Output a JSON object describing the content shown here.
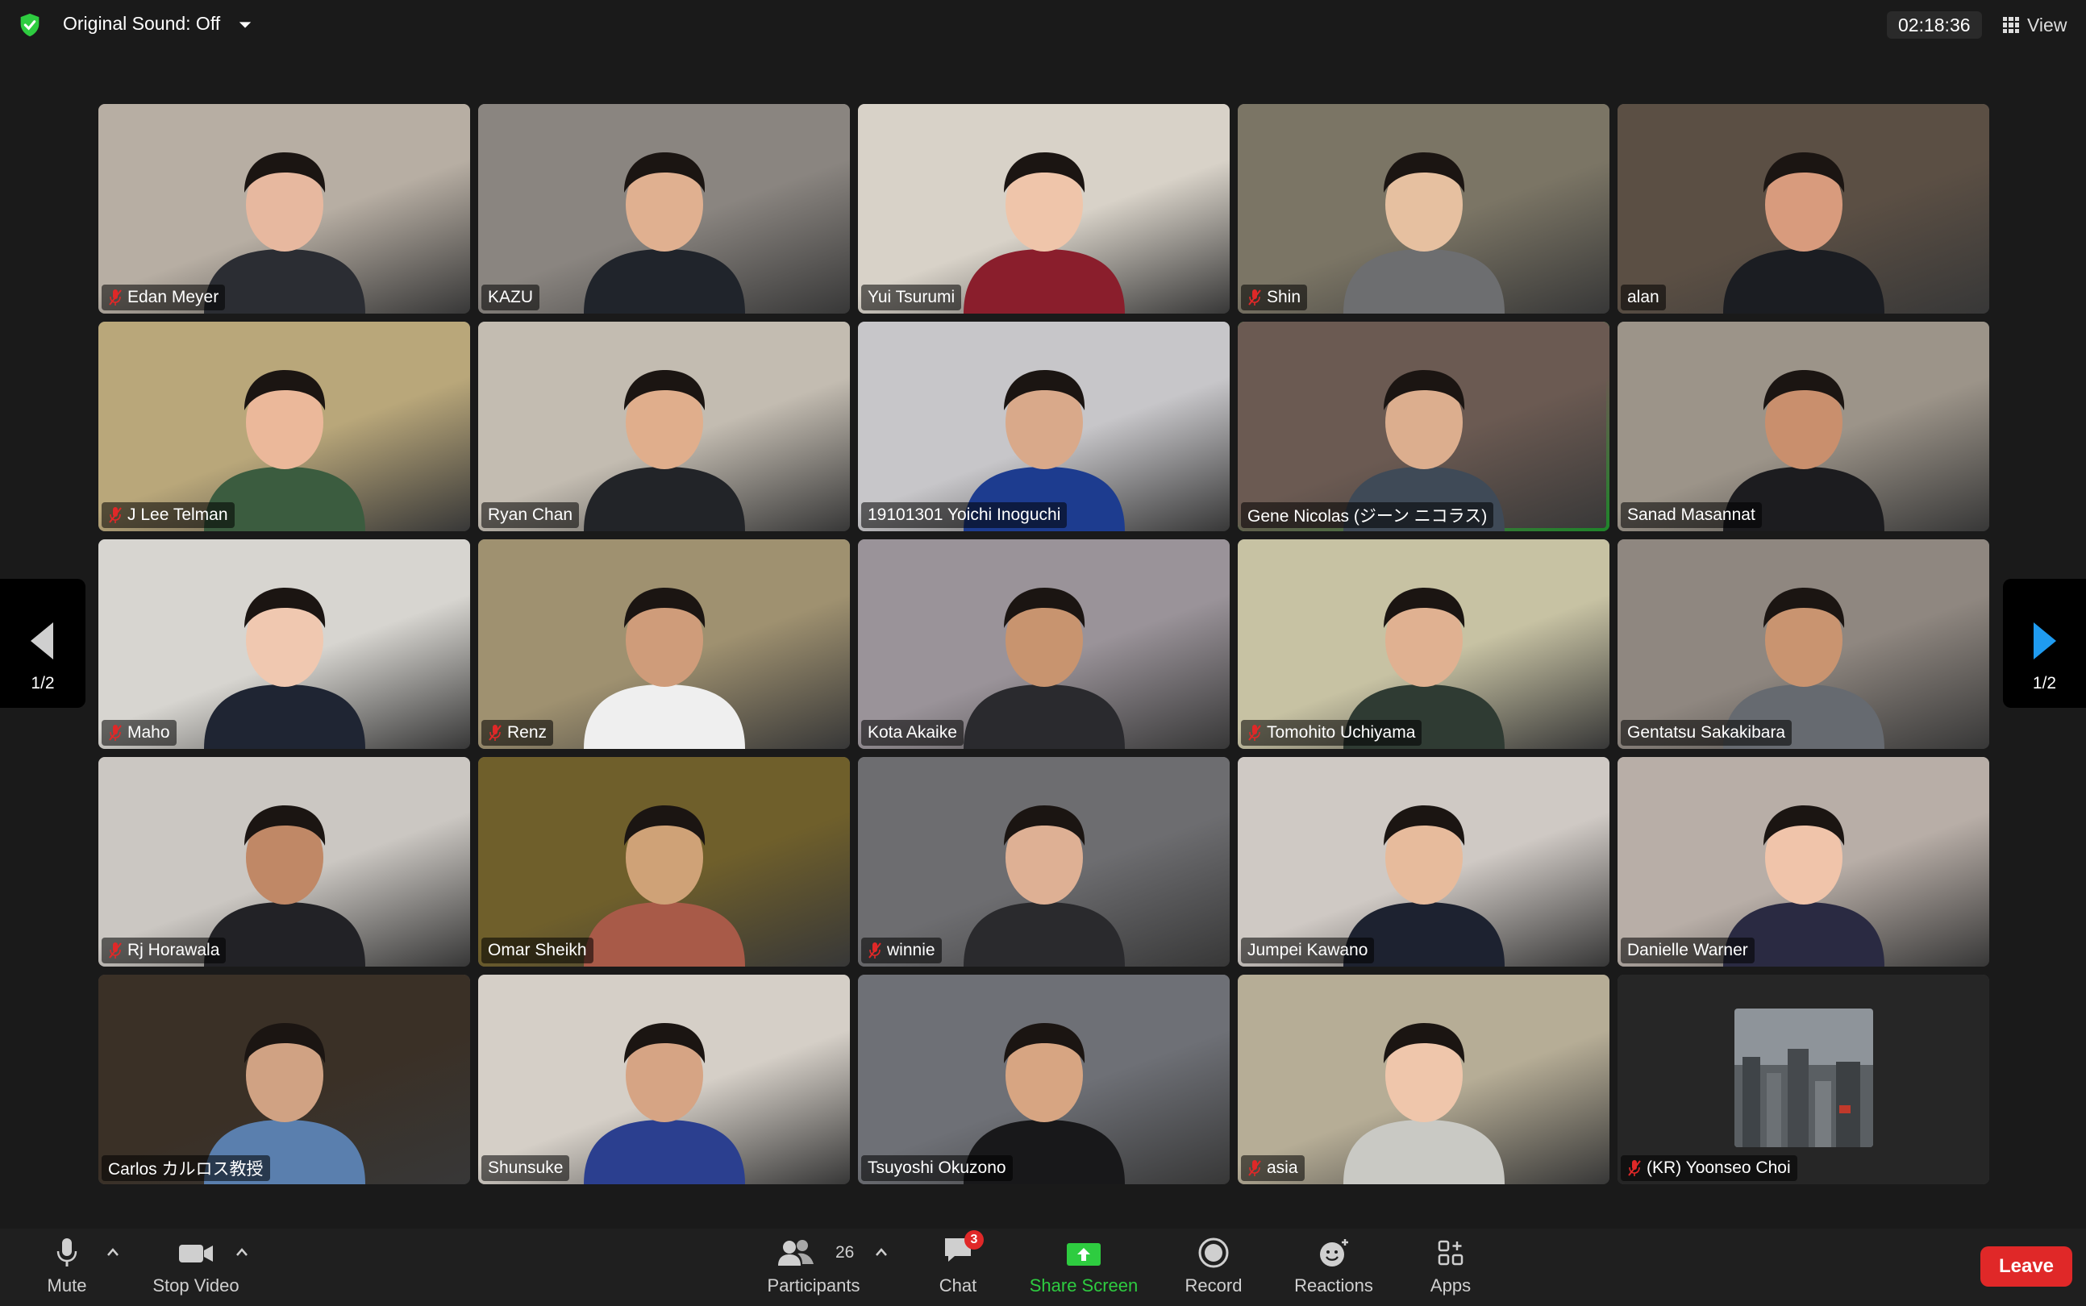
{
  "topbar": {
    "original_sound": "Original Sound: Off",
    "timer": "02:18:36",
    "view_label": "View"
  },
  "pager": {
    "left_page": "1/2",
    "right_page": "1/2"
  },
  "participants": [
    {
      "name": "Edan Meyer",
      "muted": true,
      "bg": "#b7aea3",
      "shirt": "#2b2d33",
      "skin": "#e7b89f"
    },
    {
      "name": "KAZU",
      "muted": false,
      "bg": "#8a8580",
      "shirt": "#20242b",
      "skin": "#e0b090"
    },
    {
      "name": "Yui Tsurumi",
      "muted": false,
      "bg": "#d8d2c8",
      "shirt": "#8a1e2c",
      "skin": "#efc5aa"
    },
    {
      "name": "Shin",
      "muted": true,
      "bg": "#7b7565",
      "shirt": "#6d6e70",
      "skin": "#e6c0a0"
    },
    {
      "name": "alan",
      "muted": false,
      "bg": "#5b4f44",
      "shirt": "#1b1d22",
      "skin": "#d89b7d"
    },
    {
      "name": "J Lee Telman",
      "muted": true,
      "bg": "#b9a77a",
      "shirt": "#3b5c3f",
      "skin": "#ebb89a"
    },
    {
      "name": "Ryan Chan",
      "muted": false,
      "bg": "#c3bcb1",
      "shirt": "#222428",
      "skin": "#e0ae8c"
    },
    {
      "name": "19101301 Yoichi Inoguchi",
      "muted": false,
      "bg": "#c7c6c9",
      "shirt": "#1d3c8f",
      "skin": "#d9a98a"
    },
    {
      "name": "Gene Nicolas (ジーン ニコラス)",
      "muted": false,
      "active": true,
      "bg": "#6b5a52",
      "shirt": "#3f4a57",
      "skin": "#dcae8e"
    },
    {
      "name": "Sanad Masannat",
      "muted": false,
      "bg": "#9c9489",
      "shirt": "#1c1c1f",
      "skin": "#c98f6d"
    },
    {
      "name": "Maho",
      "muted": true,
      "bg": "#d7d5d0",
      "shirt": "#1f2533",
      "skin": "#f0c8b0"
    },
    {
      "name": "Renz",
      "muted": true,
      "bg": "#9f9170",
      "shirt": "#efefef",
      "skin": "#cf9c7a"
    },
    {
      "name": "Kota Akaike",
      "muted": false,
      "bg": "#9a9399",
      "shirt": "#2a2a2e",
      "skin": "#c8946f"
    },
    {
      "name": "Tomohito Uchiyama",
      "muted": true,
      "bg": "#c7c2a3",
      "shirt": "#2f3b33",
      "skin": "#e0b191"
    },
    {
      "name": "Gentatsu Sakakibara",
      "muted": false,
      "bg": "#8f8780",
      "shirt": "#666a70",
      "skin": "#c99470"
    },
    {
      "name": "Rj Horawala",
      "muted": true,
      "bg": "#cbc7c2",
      "shirt": "#222226",
      "skin": "#c08866"
    },
    {
      "name": "Omar Sheikh",
      "muted": false,
      "bg": "#6f5f2b",
      "shirt": "#a85a48",
      "skin": "#cfa277"
    },
    {
      "name": "winnie",
      "muted": true,
      "bg": "#6d6d70",
      "shirt": "#2a2a2d",
      "skin": "#deb094"
    },
    {
      "name": "Jumpei Kawano",
      "muted": false,
      "bg": "#cfc9c4",
      "shirt": "#1d2230",
      "skin": "#e7bb9c"
    },
    {
      "name": "Danielle Warner",
      "muted": false,
      "bg": "#b8aea7",
      "shirt": "#2a2a42",
      "skin": "#f0c4aa"
    },
    {
      "name": "Carlos カルロス教授",
      "muted": false,
      "bg": "#3a3026",
      "shirt": "#5a7fae",
      "skin": "#d0a283"
    },
    {
      "name": "Shunsuke",
      "muted": false,
      "bg": "#d5cfc7",
      "shirt": "#2b3f8f",
      "skin": "#d6a484"
    },
    {
      "name": "Tsuyoshi Okuzono",
      "muted": false,
      "bg": "#6e7076",
      "shirt": "#18181a",
      "skin": "#d7a582"
    },
    {
      "name": "asia",
      "muted": true,
      "bg": "#b6ad96",
      "shirt": "#c9c9c4",
      "skin": "#efc6ab"
    },
    {
      "name": "(KR) Yoonseo Choi",
      "muted": true,
      "noVideo": true,
      "bg": "#262626",
      "shirt": "#262626",
      "skin": "#262626"
    }
  ],
  "toolbar": {
    "mute_label": "Mute",
    "stop_video_label": "Stop Video",
    "participants_label": "Participants",
    "participants_count": "26",
    "chat_label": "Chat",
    "chat_badge": "3",
    "share_label": "Share Screen",
    "record_label": "Record",
    "reactions_label": "Reactions",
    "apps_label": "Apps",
    "leave_label": "Leave"
  },
  "colors": {
    "active_speaker": "#2ecc40",
    "leave": "#e02828",
    "share": "#2ecc40",
    "background": "#1a1a1a"
  }
}
